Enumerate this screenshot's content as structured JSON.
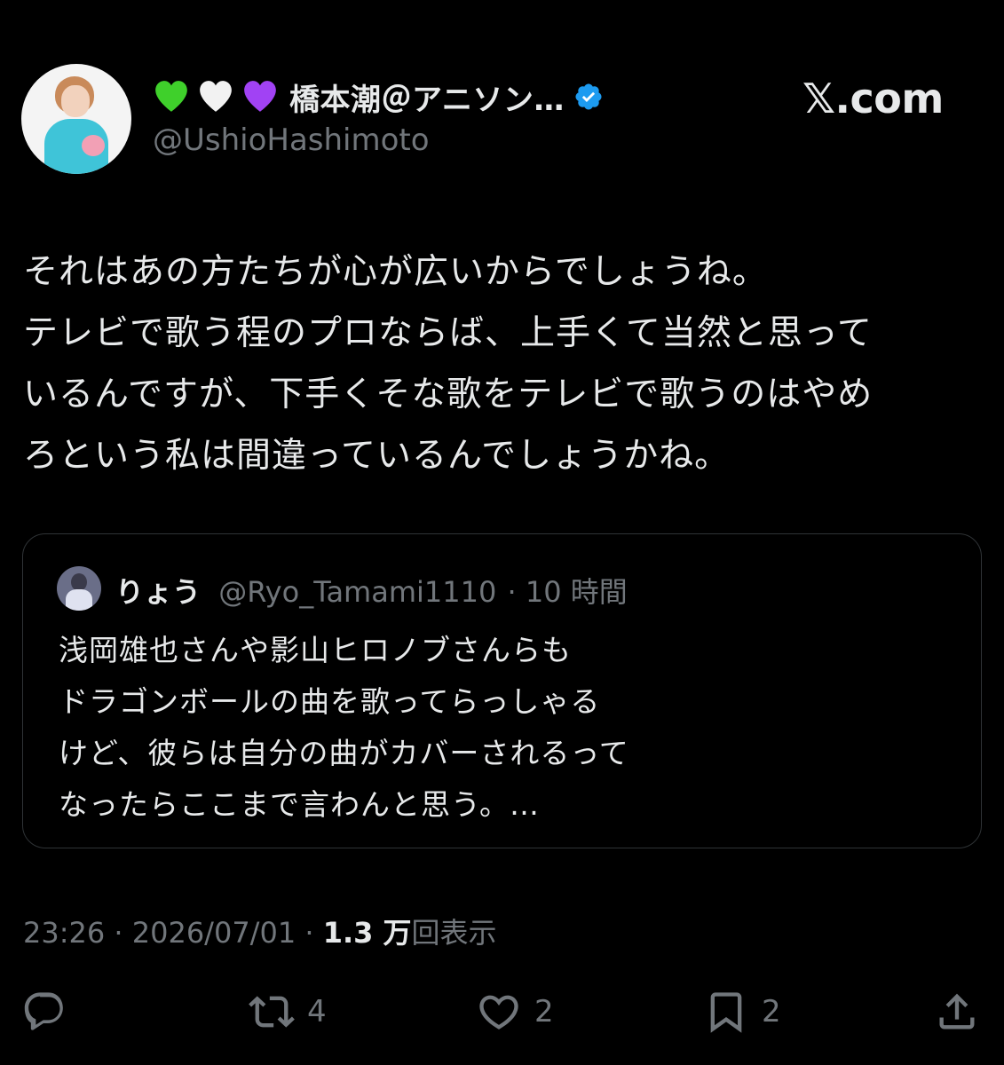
{
  "author": {
    "display_name": "橋本潮＠アニソン…",
    "handle": "@UshioHashimoto",
    "emoji_hearts": [
      "green-heart",
      "white-heart",
      "purple-heart"
    ]
  },
  "brand": "𝕏.com",
  "tweet": {
    "lines": [
      "それはあの方たちが心が広いからでしょうね。",
      "テレビで歌う程のプロならば、上手くて当然と思って",
      "いるんですが、下手くそな歌をテレビで歌うのはやめ",
      "ろという私は間違っているんでしょうかね。"
    ]
  },
  "quote": {
    "name": "りょう",
    "handle": "@Ryo_Tamami1110",
    "time": "· 10 時間",
    "lines": [
      "浅岡雄也さんや影山ヒロノブさんらも",
      "ドラゴンボールの曲を歌ってらっしゃる",
      "けど、彼らは自分の曲がカバーされるって",
      "なったらここまで言わんと思う。…"
    ]
  },
  "meta": {
    "time": "23:26 · 2026/07/01 · ",
    "views_count": "1.3 万",
    "views_label": "回表示"
  },
  "actions": {
    "reply_count": "",
    "retweet_count": "4",
    "like_count": "2",
    "bookmark_count": "2"
  },
  "colors": {
    "background": "#000000",
    "text": "#e7e9ea",
    "muted": "#71767b",
    "verified": "#1d9bf0",
    "border": "#2f3336"
  }
}
